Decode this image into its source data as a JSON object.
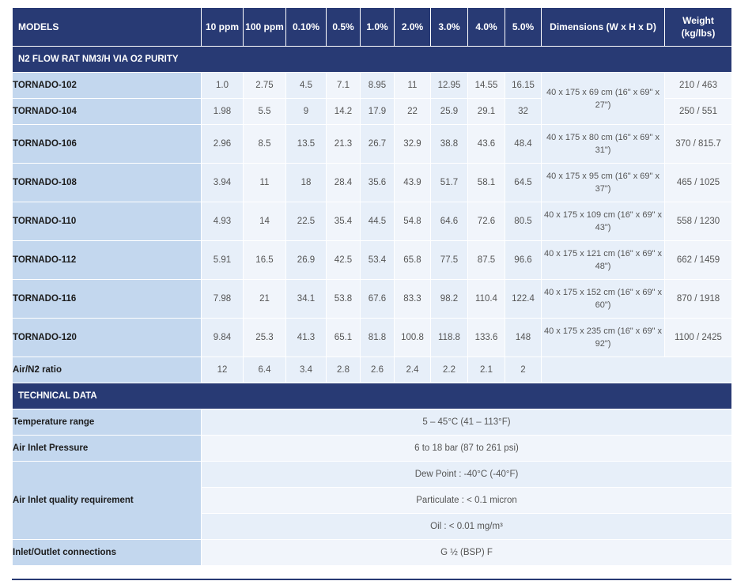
{
  "headers": [
    "MODELS",
    "10 ppm",
    "100 ppm",
    "0.10%",
    "0.5%",
    "1.0%",
    "2.0%",
    "3.0%",
    "4.0%",
    "5.0%",
    "Dimensions (W x H x D)",
    "Weight (kg/lbs)"
  ],
  "section_flow": "N2 FLOW RAT NM3/H VIA O2 PURITY",
  "rows": [
    {
      "model": "TORNADO-102",
      "values": [
        "1.0",
        "2.75",
        "4.5",
        "7.1",
        "8.95",
        "11",
        "12.95",
        "14.55",
        "16.15"
      ],
      "weight": "210 / 463"
    },
    {
      "model": "TORNADO-104",
      "values": [
        "1.98",
        "5.5",
        "9",
        "14.2",
        "17.9",
        "22",
        "25.9",
        "29.1",
        "32"
      ],
      "weight": "250 / 551"
    },
    {
      "model": "TORNADO-106",
      "values": [
        "2.96",
        "8.5",
        "13.5",
        "21.3",
        "26.7",
        "32.9",
        "38.8",
        "43.6",
        "48.4"
      ],
      "dims": "40 x 175 x 80 cm (16\" x 69\" x 31\")",
      "weight": "370 / 815.7"
    },
    {
      "model": "TORNADO-108",
      "values": [
        "3.94",
        "11",
        "18",
        "28.4",
        "35.6",
        "43.9",
        "51.7",
        "58.1",
        "64.5"
      ],
      "dims": "40 x 175 x 95 cm (16\" x 69\" x 37\")",
      "weight": "465 / 1025"
    },
    {
      "model": "TORNADO-110",
      "values": [
        "4.93",
        "14",
        "22.5",
        "35.4",
        "44.5",
        "54.8",
        "64.6",
        "72.6",
        "80.5"
      ],
      "dims": "40 x 175 x 109 cm (16\" x 69\" x 43\")",
      "weight": "558 / 1230"
    },
    {
      "model": "TORNADO-112",
      "values": [
        "5.91",
        "16.5",
        "26.9",
        "42.5",
        "53.4",
        "65.8",
        "77.5",
        "87.5",
        "96.6"
      ],
      "dims": "40 x 175 x 121 cm (16\" x 69\" x 48\")",
      "weight": "662 / 1459"
    },
    {
      "model": "TORNADO-116",
      "values": [
        "7.98",
        "21",
        "34.1",
        "53.8",
        "67.6",
        "83.3",
        "98.2",
        "110.4",
        "122.4"
      ],
      "dims": "40 x 175 x 152 cm (16\" x 69\" x 60\")",
      "weight": "870 / 1918"
    },
    {
      "model": "TORNADO-120",
      "values": [
        "9.84",
        "25.3",
        "41.3",
        "65.1",
        "81.8",
        "100.8",
        "118.8",
        "133.6",
        "148"
      ],
      "dims": "40 x 175 x 235 cm (16\" x 69\" x 92\")",
      "weight": "1100 / 2425"
    }
  ],
  "dims_shared_102_104": "40 x 175 x 69 cm (16\" x 69\" x 27\")",
  "ratio": {
    "label": "Air/N2 ratio",
    "values": [
      "12",
      "6.4",
      "3.4",
      "2.8",
      "2.6",
      "2.4",
      "2.2",
      "2.1",
      "2"
    ]
  },
  "section_tech": "TECHNICAL DATA",
  "tech": {
    "temperature": {
      "label": "Temperature range",
      "value": "5 – 45°C (41 – 113°F)"
    },
    "pressure": {
      "label": "Air Inlet Pressure",
      "value": "6 to 18 bar (87 to 261 psi)"
    },
    "quality": {
      "label": "Air Inlet quality requirement",
      "values": [
        "Dew Point : -40°C (-40°F)",
        "Particulate : < 0.1 micron",
        "Oil : < 0.01 mg/m³"
      ]
    },
    "connections": {
      "label": "Inlet/Outlet connections",
      "value": "G ½ (BSP) F"
    }
  },
  "colors": {
    "header_bg": "#283a74",
    "label_bg": "#c3d7ee",
    "cell_bg": "#e7eff9",
    "cell_bg_alt": "#f1f5fb"
  }
}
